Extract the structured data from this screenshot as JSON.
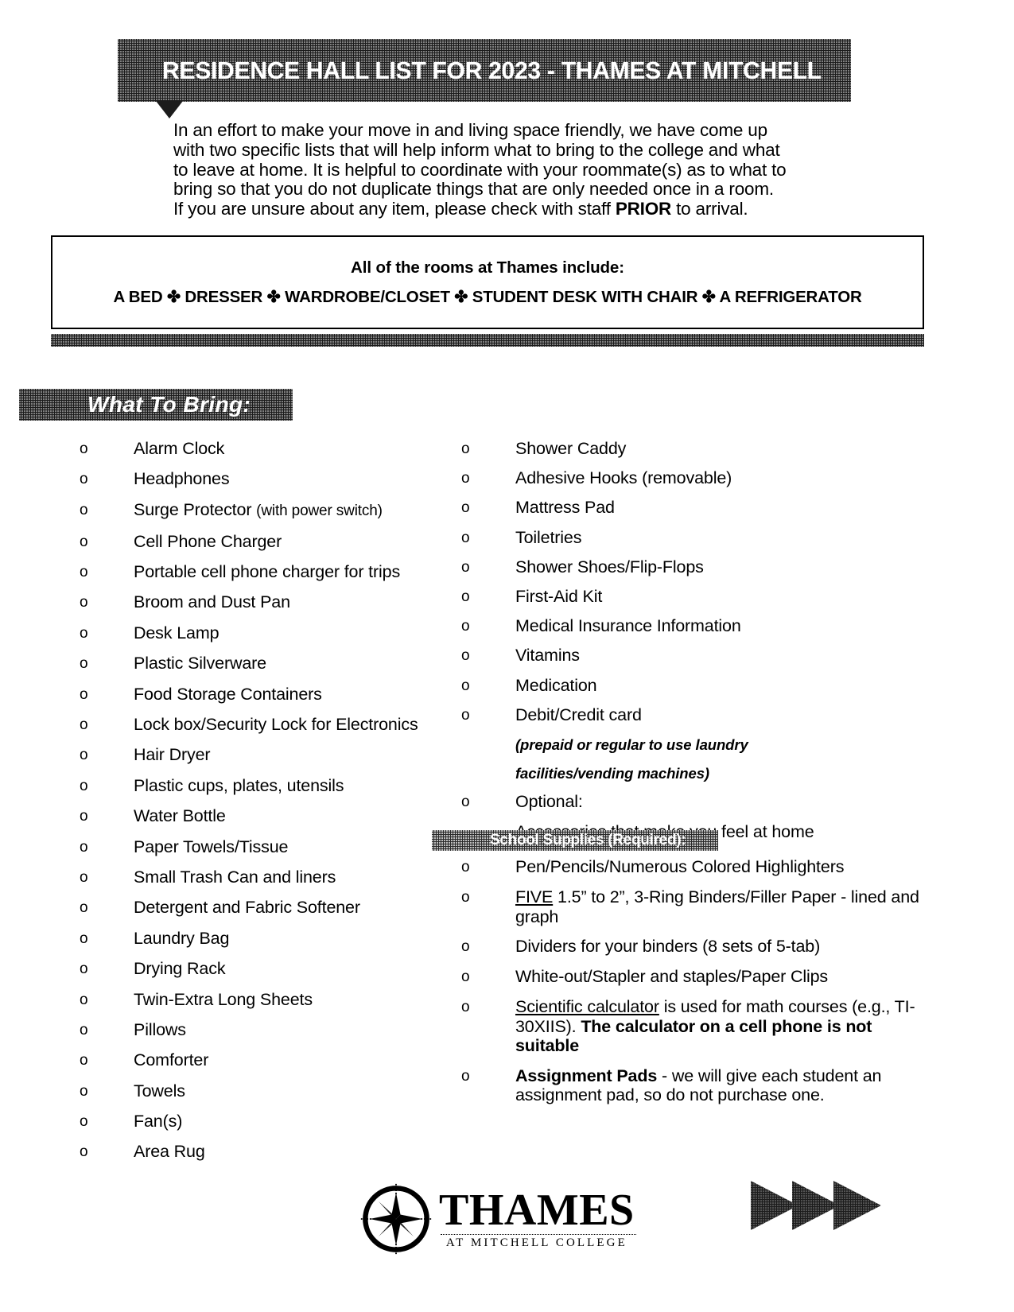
{
  "document": {
    "title": "RESIDENCE HALL LIST FOR 2023 - THAMES AT MITCHELL",
    "intro_line1": "In an effort to make your move in and living space friendly, we have come up",
    "intro_line2": "with two specific lists that will help inform what to bring to the college and what",
    "intro_line3": "to leave at home. It is helpful to coordinate with your roommate(s) as to what to",
    "intro_line4": "bring so that you do not duplicate things that are only needed once in a room.",
    "intro_line5_a": "If you are unsure about any item, please check with staff ",
    "intro_line5_bold": "PRIOR",
    "intro_line5_b": " to arrival."
  },
  "rooms_box": {
    "heading": "All of the rooms at Thames include:",
    "contents": "A BED ✤ DRESSER ✤ WARDROBE/CLOSET ✤ STUDENT DESK WITH CHAIR  ✤ A REFRIGERATOR"
  },
  "what_to_bring": {
    "banner_label": "What To Bring:",
    "bullet_glyph": "o",
    "left_column": [
      {
        "text": "Alarm Clock"
      },
      {
        "text": "Headphones"
      },
      {
        "text": "Surge Protector ",
        "small_suffix": "(with power switch)"
      },
      {
        "text": "Cell Phone Charger"
      },
      {
        "text": "Portable cell phone charger for trips"
      },
      {
        "text": "Broom and Dust Pan"
      },
      {
        "text": "Desk Lamp"
      },
      {
        "text": "Plastic Silverware"
      },
      {
        "text": "Food Storage Containers"
      },
      {
        "text": "Lock box/Security Lock for Electronics"
      },
      {
        "text": "Hair Dryer"
      },
      {
        "text": "Plastic cups, plates, utensils"
      },
      {
        "text": "Water Bottle"
      },
      {
        "text": "Paper Towels/Tissue"
      },
      {
        "text": "Small Trash Can and liners"
      },
      {
        "text": "Detergent and Fabric Softener"
      },
      {
        "text": "Laundry Bag"
      },
      {
        "text": "Drying Rack"
      },
      {
        "text": "Twin-Extra Long Sheets"
      },
      {
        "text": "Pillows"
      },
      {
        "text": "Comforter"
      },
      {
        "text": "Towels"
      },
      {
        "text": "Fan(s)"
      },
      {
        "text": "Area Rug"
      }
    ],
    "right_column": [
      {
        "text": "Shower Caddy"
      },
      {
        "text": "Adhesive Hooks (removable)"
      },
      {
        "text": "Mattress Pad"
      },
      {
        "text": "Toiletries"
      },
      {
        "text": "Shower Shoes/Flip-Flops"
      },
      {
        "text": "First-Aid Kit"
      },
      {
        "text": "Medical Insurance Information"
      },
      {
        "text": "Vitamins"
      },
      {
        "text": "Medication"
      },
      {
        "text": "Debit/Credit card"
      }
    ],
    "debit_note_line1": "(prepaid or regular to use laundry",
    "debit_note_line2": "facilities/vending machines)",
    "optional_label": "Optional:",
    "optional_note": "Accessories that make you feel at home"
  },
  "school_supplies": {
    "banner_label": "School Supplies (Required):",
    "items": [
      {
        "plain": "Pen/Pencils/Numerous Colored Highlighters"
      },
      {
        "underline": "FIVE",
        "plain": " 1.5” to 2”, 3-Ring Binders/Filler Paper - lined and graph"
      },
      {
        "plain": "Dividers for your binders (8 sets of 5-tab)"
      },
      {
        "plain": "White-out/Stapler and staples/Paper Clips"
      },
      {
        "underline": "Scientific calculator",
        "plain": " is used for math courses (e.g., TI-30XIIS). ",
        "bold": "The calculator on a cell phone is not suitable"
      },
      {
        "bold_lead": "Assignment Pads",
        "plain": " - we will give each student an assignment pad, so do not purchase one."
      }
    ]
  },
  "footer": {
    "logo_wordmark": "THAMES",
    "logo_tagline": "AT MITCHELL COLLEGE",
    "logo_icon": "compass-rose-icon",
    "arrows_icon": "triple-chevron-arrows-icon"
  },
  "colors": {
    "banner_fill": "#1c1c1c",
    "text": "#000000",
    "page_background": "#ffffff"
  }
}
